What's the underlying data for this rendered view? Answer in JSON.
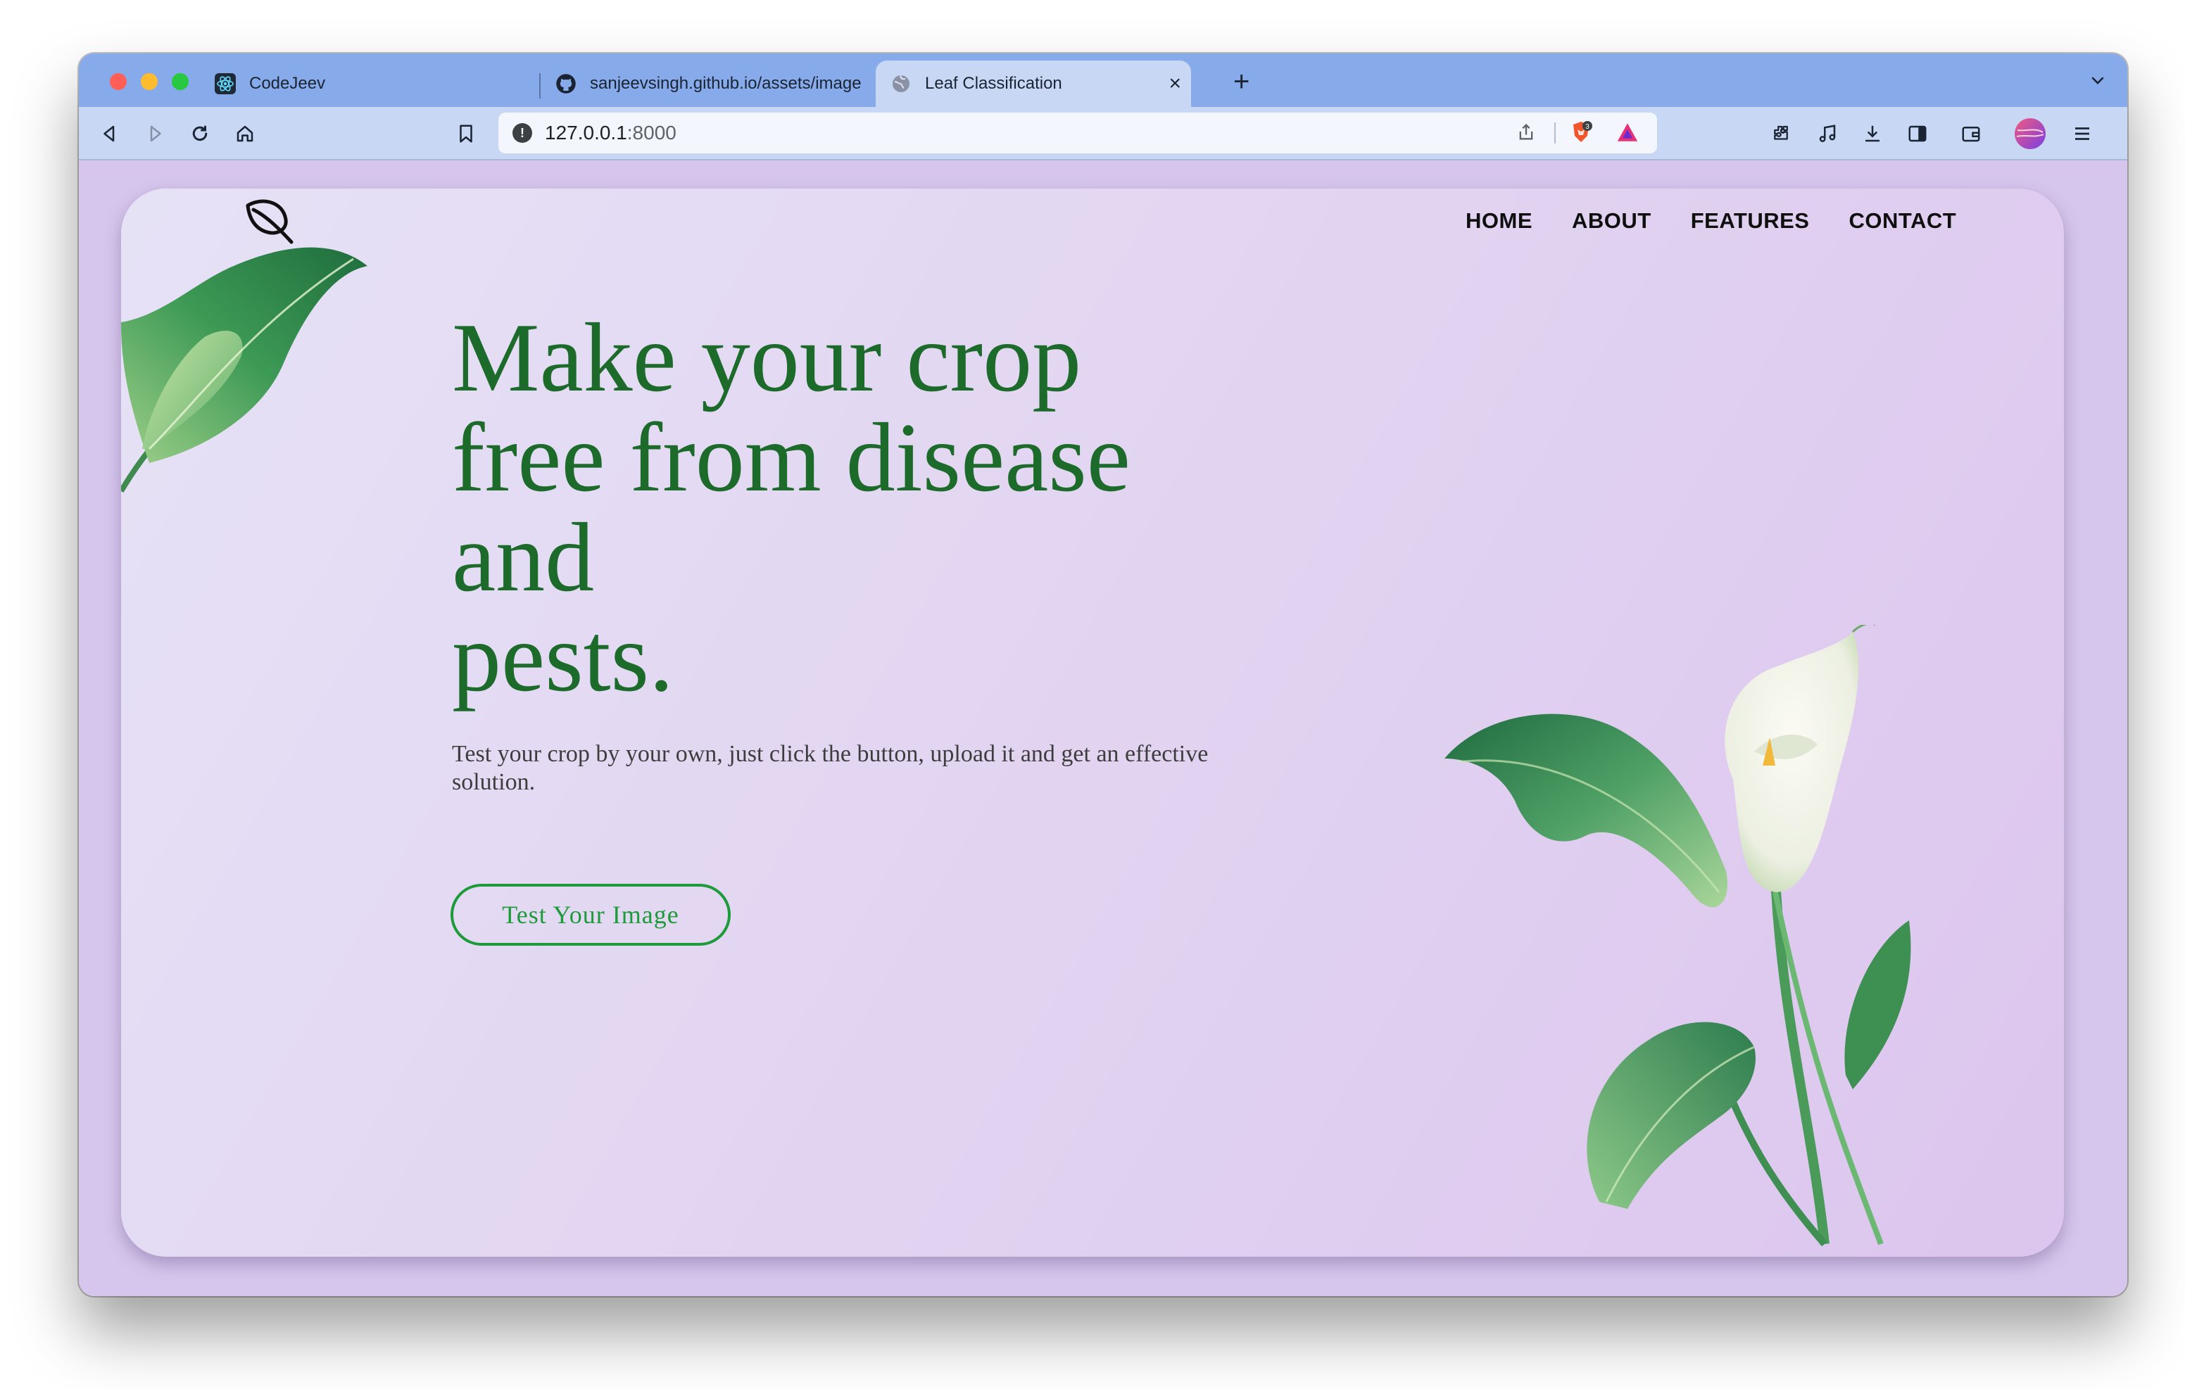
{
  "browser": {
    "tabs": [
      {
        "label": "CodeJeev",
        "icon": "react-icon",
        "active": false
      },
      {
        "label": "sanjeevsingh.github.io/assets/image",
        "icon": "github-icon",
        "active": false
      },
      {
        "label": "Leaf Classification",
        "icon": "globe-icon",
        "active": true
      }
    ],
    "address": {
      "host": "127.0.0.1",
      "port": ":8000"
    },
    "shields_count": "3"
  },
  "site": {
    "nav": [
      "HOME",
      "ABOUT",
      "FEATURES",
      "CONTACT"
    ],
    "headline": [
      "Make your crop",
      "free from disease",
      "and",
      "pests."
    ],
    "subtext": "Test your crop by your own, just click the button, upload it and get an effective solution.",
    "cta": "Test Your Image"
  },
  "colors": {
    "tab_strip": "#86aaea",
    "toolbar": "#c8d7f4",
    "headline": "#1c6b2a",
    "cta": "#1d9b3a",
    "page_bg": "#d6c6ed"
  }
}
